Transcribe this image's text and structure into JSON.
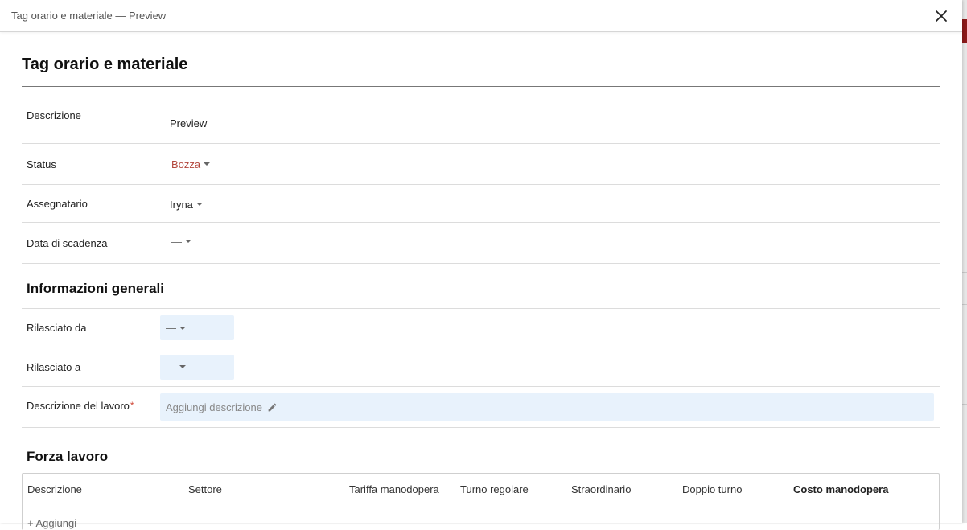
{
  "header": {
    "title": "Tag orario e materiale — Preview"
  },
  "page": {
    "title": "Tag orario e materiale"
  },
  "fields": {
    "descrizione": {
      "label": "Descrizione",
      "value": "Preview"
    },
    "status": {
      "label": "Status",
      "value": "Bozza"
    },
    "assegnatario": {
      "label": "Assegnatario",
      "value": "Iryna"
    },
    "scadenza": {
      "label": "Data di scadenza",
      "value": "—"
    }
  },
  "general": {
    "title": "Informazioni generali",
    "rilasciato_da": {
      "label": "Rilasciato da",
      "value": "—"
    },
    "rilasciato_a": {
      "label": "Rilasciato a",
      "value": "—"
    },
    "lavoro": {
      "label": "Descrizione del lavoro",
      "required": "*",
      "placeholder": "Aggiungi descrizione"
    }
  },
  "workforce": {
    "title": "Forza lavoro",
    "columns": [
      "Descrizione",
      "Settore",
      "Tariffa manodopera",
      "Turno regolare",
      "Straordinario",
      "Doppio turno",
      "Costo manodopera"
    ],
    "add_label": "+ Aggiungi"
  },
  "colors": {
    "status": "#b3473d",
    "field_bg": "#e8f2fc",
    "required": "#d04a3a"
  }
}
